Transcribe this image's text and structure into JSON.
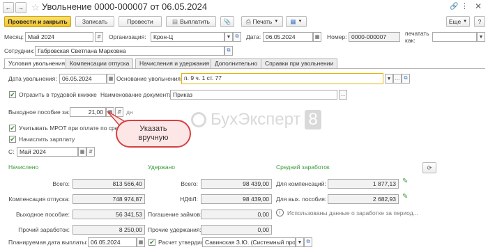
{
  "window": {
    "title": "Увольнение 0000-000007 от 06.05.2024"
  },
  "toolbar": {
    "post_close": "Провести и закрыть",
    "save": "Записать",
    "post": "Провести",
    "pay": "Выплатить",
    "print": "Печать",
    "more": "Еще",
    "help": "?"
  },
  "header": {
    "month_label": "Месяц:",
    "month_value": "Май 2024",
    "org_label": "Организация:",
    "org_value": "Крон-Ц",
    "date_label": "Дата:",
    "date_value": "06.05.2024",
    "number_label": "Номер:",
    "number_value": "0000-000007",
    "print_as_label": "печатать как:",
    "employee_label": "Сотрудник:",
    "employee_value": "Габровская Светлана Марковна"
  },
  "tabs": [
    {
      "label": "Условия увольнения"
    },
    {
      "label": "Компенсации отпуска"
    },
    {
      "label": "Начисления и удержания"
    },
    {
      "label": "Дополнительно"
    },
    {
      "label": "Справки при увольнении"
    }
  ],
  "conditions": {
    "dismissal_date_label": "Дата увольнения:",
    "dismissal_date": "06.05.2024",
    "basis_label": "Основание увольнения:",
    "basis_value": "п. 9 ч. 1 ст. 77",
    "reflect_label": "Отразить в трудовой книжке",
    "doc_name_label": "Наименование документа:",
    "doc_name_value": "Приказ",
    "severance_label": "Выходное пособие за:",
    "severance_value": "21,00",
    "severance_unit": "дн",
    "mrot_label": "Учитывать МРОТ при оплате по сре",
    "accrue_label": "Начислить зарплату",
    "from_label": "С:",
    "from_value": "Май 2024"
  },
  "callout": {
    "text": "Указать вручную"
  },
  "watermark": {
    "text": "БухЭксперт",
    "digit": "8"
  },
  "accrued": {
    "heading": "Начислено",
    "rows": [
      {
        "label": "Всего:",
        "value": "813 566,40"
      },
      {
        "label": "Компенсация отпуска:",
        "value": "748 974,87"
      },
      {
        "label": "Выходное пособие:",
        "value": "56 341,53"
      },
      {
        "label": "Прочий заработок:",
        "value": "8 250,00"
      }
    ]
  },
  "withheld": {
    "heading": "Удержано",
    "rows": [
      {
        "label": "Всего:",
        "value": "98 439,00"
      },
      {
        "label": "НДФЛ:",
        "value": "98 439,00"
      },
      {
        "label": "Погашение займов:",
        "value": "0,00"
      },
      {
        "label": "Прочие удержания:",
        "value": "0,00"
      }
    ]
  },
  "avg": {
    "heading": "Средний заработок",
    "comp_label": "Для компенсаций:",
    "comp_value": "1 877,13",
    "sev_label": "Для вых. пособия:",
    "sev_value": "2 682,93",
    "note": "Использованы данные о заработке за период..."
  },
  "footer": {
    "planned_label": "Планируемая дата выплаты:",
    "planned_value": "06.05.2024",
    "approved_label": "Расчет утвердил",
    "approved_value": "Савинская З.Ю. (Системный про"
  },
  "colors": {
    "primary": "#f2c22b",
    "accent_green": "#3a9a3a",
    "callout_border": "#d64040",
    "callout_fill": "#fde6e6"
  }
}
